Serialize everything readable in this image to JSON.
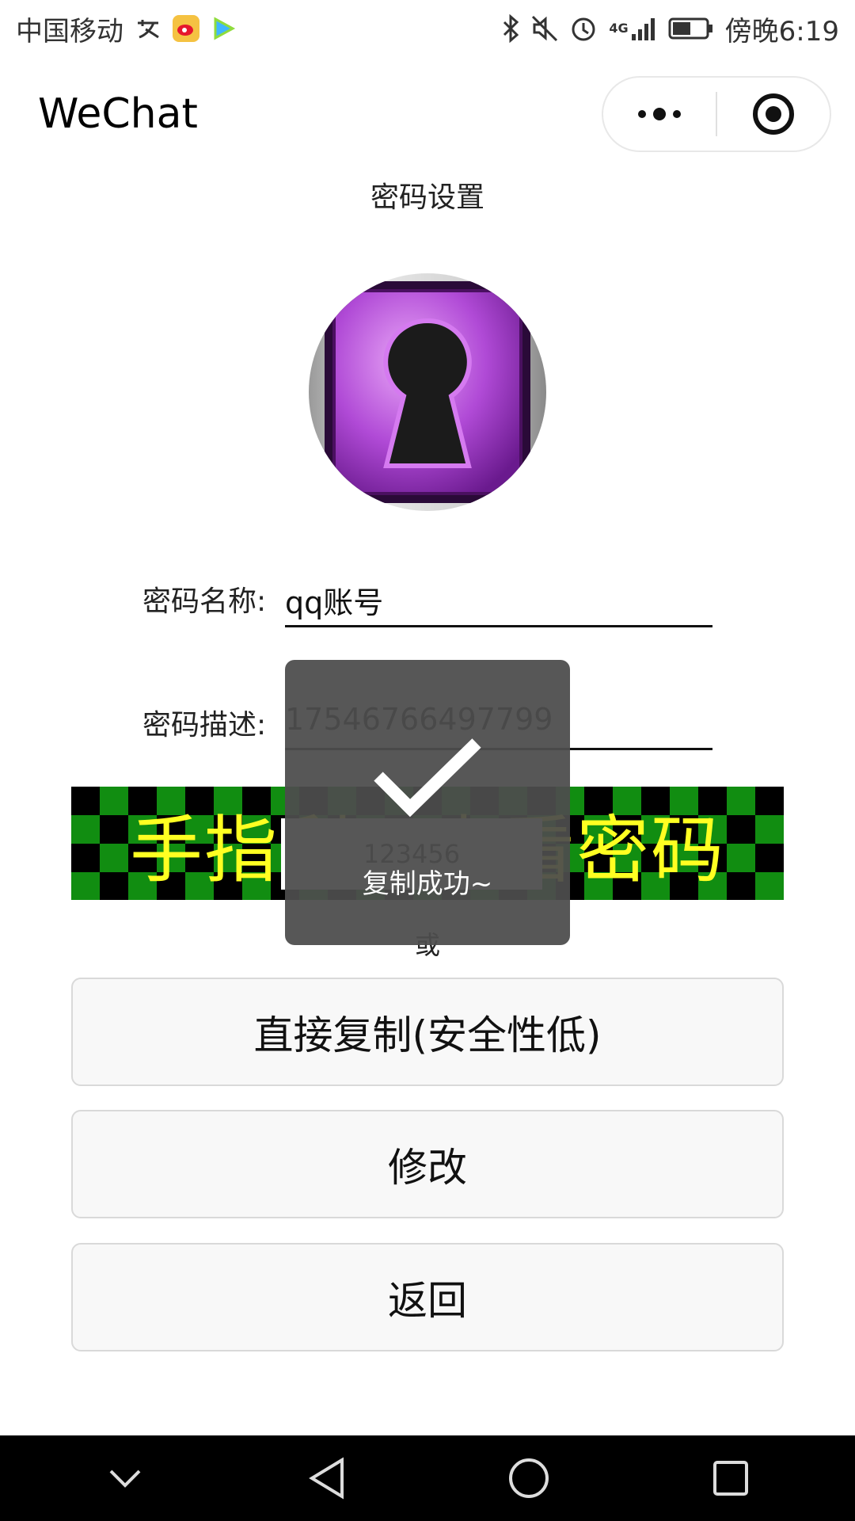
{
  "status_bar": {
    "carrier": "中国移动",
    "network": "4G",
    "time": "傍晚6:19",
    "icons": [
      "alipay-icon",
      "weibo-icon",
      "video-app-icon",
      "bluetooth-icon",
      "mute-icon",
      "alarm-icon",
      "signal-icon",
      "battery-icon"
    ]
  },
  "nav": {
    "title": "WeChat",
    "more_icon": "more-dots-icon",
    "close_icon": "target-icon"
  },
  "page": {
    "heading": "密码设置"
  },
  "form": {
    "name_label": "密码名称:",
    "name_value": "qq账号",
    "desc_label": "密码描述:",
    "desc_value": "17546766497799"
  },
  "scratch_card": {
    "text": "手指刮开查看密码",
    "revealed_password": "123456",
    "colors": {
      "checker_dark": "#000000",
      "checker_green": "#118d11",
      "text": "#ffff22"
    }
  },
  "or_text": "或",
  "buttons": {
    "copy": "直接复制(安全性低)",
    "edit": "修改",
    "back": "返回"
  },
  "toast": {
    "message": "复制成功~",
    "icon": "checkmark-icon"
  },
  "colors": {
    "lock_purple": "#b04ad6",
    "button_bg": "#f8f8f8",
    "toast_bg": "#4c4c4c"
  }
}
